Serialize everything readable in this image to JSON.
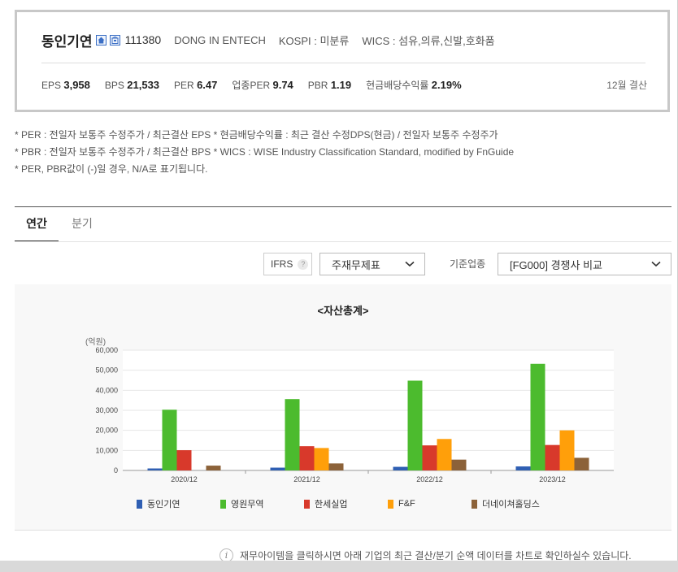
{
  "company": {
    "name": "동인기연",
    "code": "111380",
    "english_name": "DONG IN ENTECH",
    "market": "KOSPI : 미분류",
    "wics": "WICS : 섬유,의류,신발,호화품"
  },
  "stats": [
    {
      "label": "EPS",
      "value": "3,958"
    },
    {
      "label": "BPS",
      "value": "21,533"
    },
    {
      "label": "PER",
      "value": "6.47"
    },
    {
      "label": "업종PER",
      "value": "9.74"
    },
    {
      "label": "PBR",
      "value": "1.19"
    },
    {
      "label": "현금배당수익률",
      "value": "2.19%"
    }
  ],
  "settlement": "12월 결산",
  "notes": [
    "* PER : 전일자 보통주 수정주가 / 최근결산 EPS * 현금배당수익률 : 최근 결산 수정DPS(현금) / 전일자 보통주 수정주가",
    "* PBR : 전일자 보통주 수정주가 / 최근결산 BPS * WICS : WISE Industry Classification Standard, modified by FnGuide",
    "* PER, PBR값이 (-)일 경우, N/A로 표기됩니다."
  ],
  "tabs": {
    "annual": "연간",
    "quarter": "분기"
  },
  "controls": {
    "ifrs": "IFRS",
    "help": "?",
    "statement": "주재무제표",
    "industry_label": "기준업종",
    "industry_select": "[FG000] 경쟁사 비교"
  },
  "chart_data": {
    "type": "bar",
    "title": "<자산총계>",
    "ylabel": "(억원)",
    "ylim": [
      0,
      60000
    ],
    "yticks": [
      "0",
      "10,000",
      "20,000",
      "30,000",
      "40,000",
      "50,000",
      "60,000"
    ],
    "categories": [
      "2020/12",
      "2021/12",
      "2022/12",
      "2023/12"
    ],
    "series": [
      {
        "name": "동인기연",
        "color": "#2f5fb3",
        "values": [
          1000,
          1400,
          1800,
          2000
        ]
      },
      {
        "name": "영원무역",
        "color": "#4cbb2e",
        "values": [
          30300,
          35600,
          44800,
          53200
        ]
      },
      {
        "name": "한세실업",
        "color": "#d8392b",
        "values": [
          10100,
          12100,
          12500,
          12700
        ]
      },
      {
        "name": "F&F",
        "color": "#ff9f0a",
        "values": null
      },
      {
        "name": "더네이쳐홀딩스",
        "color": "#8c6239",
        "values": [
          2400,
          3500,
          5400,
          6300
        ]
      }
    ],
    "ff_values": [
      null,
      11200,
      15700,
      20000
    ],
    "grid": true
  },
  "footer": {
    "info_icon": "i",
    "info_text": "재무아이템을 클릭하시면 아래 기업의 최근 결산/분기 순액 데이터를 차트로 확인하실수 있습니다."
  }
}
